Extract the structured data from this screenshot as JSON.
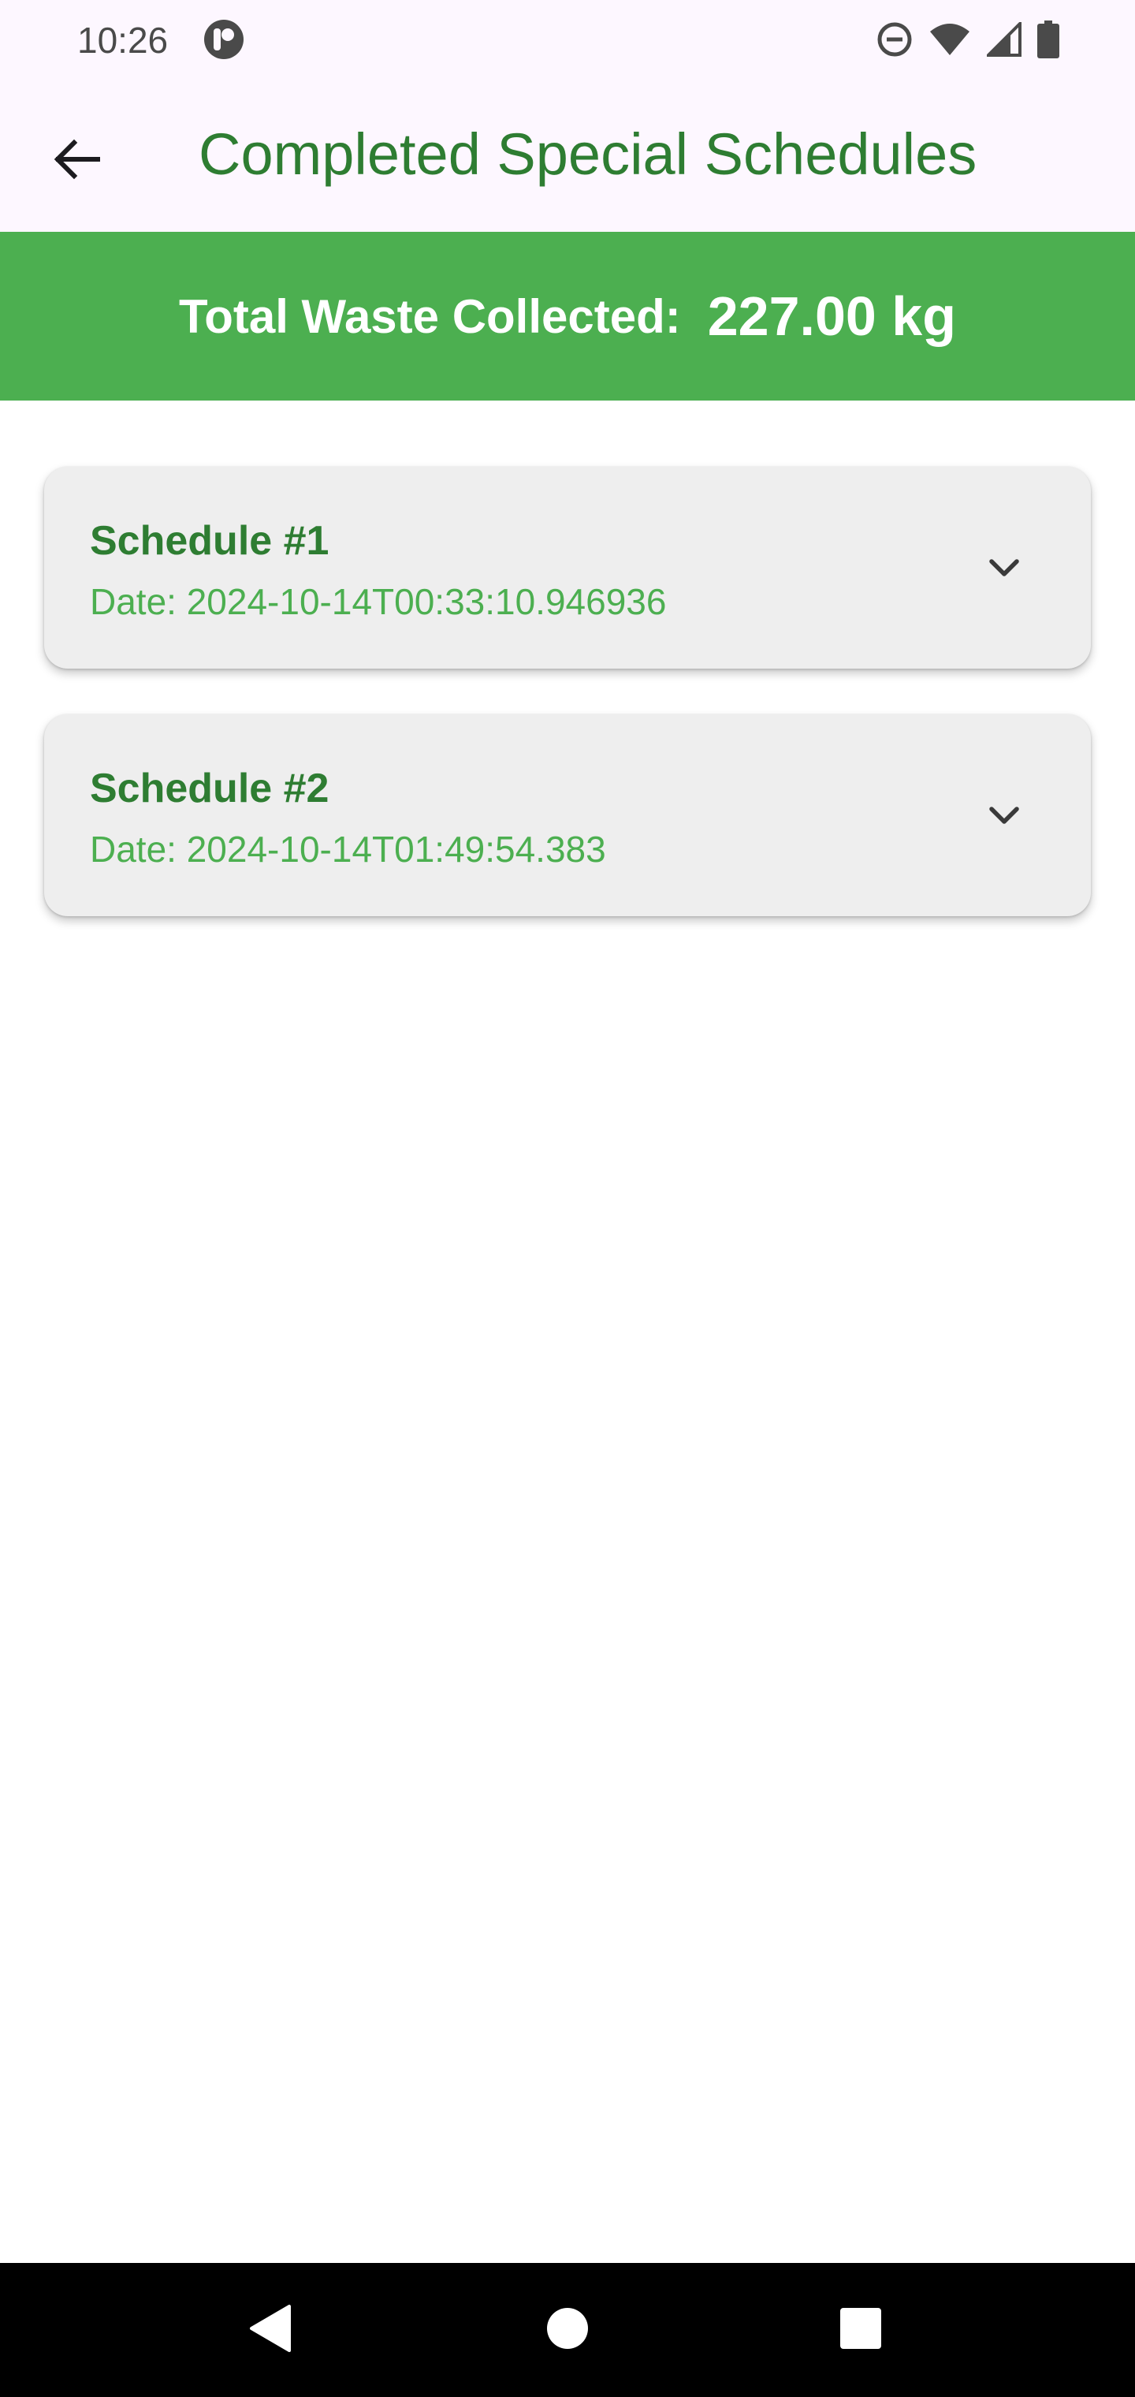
{
  "status_bar": {
    "time": "10:26",
    "icons": [
      "app-notification-icon",
      "do-not-disturb-icon",
      "wifi-icon",
      "cell-signal-icon",
      "battery-icon"
    ]
  },
  "app_bar": {
    "title": "Completed Special Schedules",
    "back_icon": "arrow-back-icon"
  },
  "summary": {
    "label": "Total Waste Collected:",
    "value": "227.00 kg"
  },
  "schedules": [
    {
      "title": "Schedule #1",
      "date": "Date: 2024-10-14T00:33:10.946936",
      "icon": "chevron-down-icon"
    },
    {
      "title": "Schedule #2",
      "date": "Date: 2024-10-14T01:49:54.383",
      "icon": "chevron-down-icon"
    }
  ],
  "nav_bar": {
    "icons": [
      "nav-back-icon",
      "nav-home-icon",
      "nav-recents-icon"
    ]
  },
  "colors": {
    "primary_green": "#2e7d32",
    "banner_green": "#4caf50",
    "card_bg": "#eeeeee",
    "top_bg": "#fdf7ff"
  }
}
